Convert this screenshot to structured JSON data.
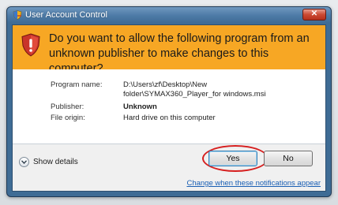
{
  "window": {
    "title": "User Account Control",
    "close_label": "✕"
  },
  "banner": {
    "question": "Do you want to allow the following program from an unknown publisher to make changes to this computer?"
  },
  "details": {
    "program_name_label": "Program name:",
    "program_name_line1": "D:\\Users\\zf\\Desktop\\New",
    "program_name_line2": "folder\\SYMAX360_Player_for windows.msi",
    "publisher_label": "Publisher:",
    "publisher_value": "Unknown",
    "file_origin_label": "File origin:",
    "file_origin_value": "Hard drive on this computer"
  },
  "footer": {
    "show_details_label": "Show details",
    "yes_label": "Yes",
    "no_label": "No",
    "change_link": "Change when these notifications appear"
  },
  "colors": {
    "banner": "#f7a724",
    "titlebar": "#4d7aa6",
    "link": "#1a5fb4",
    "annotation": "#d61f1f"
  }
}
